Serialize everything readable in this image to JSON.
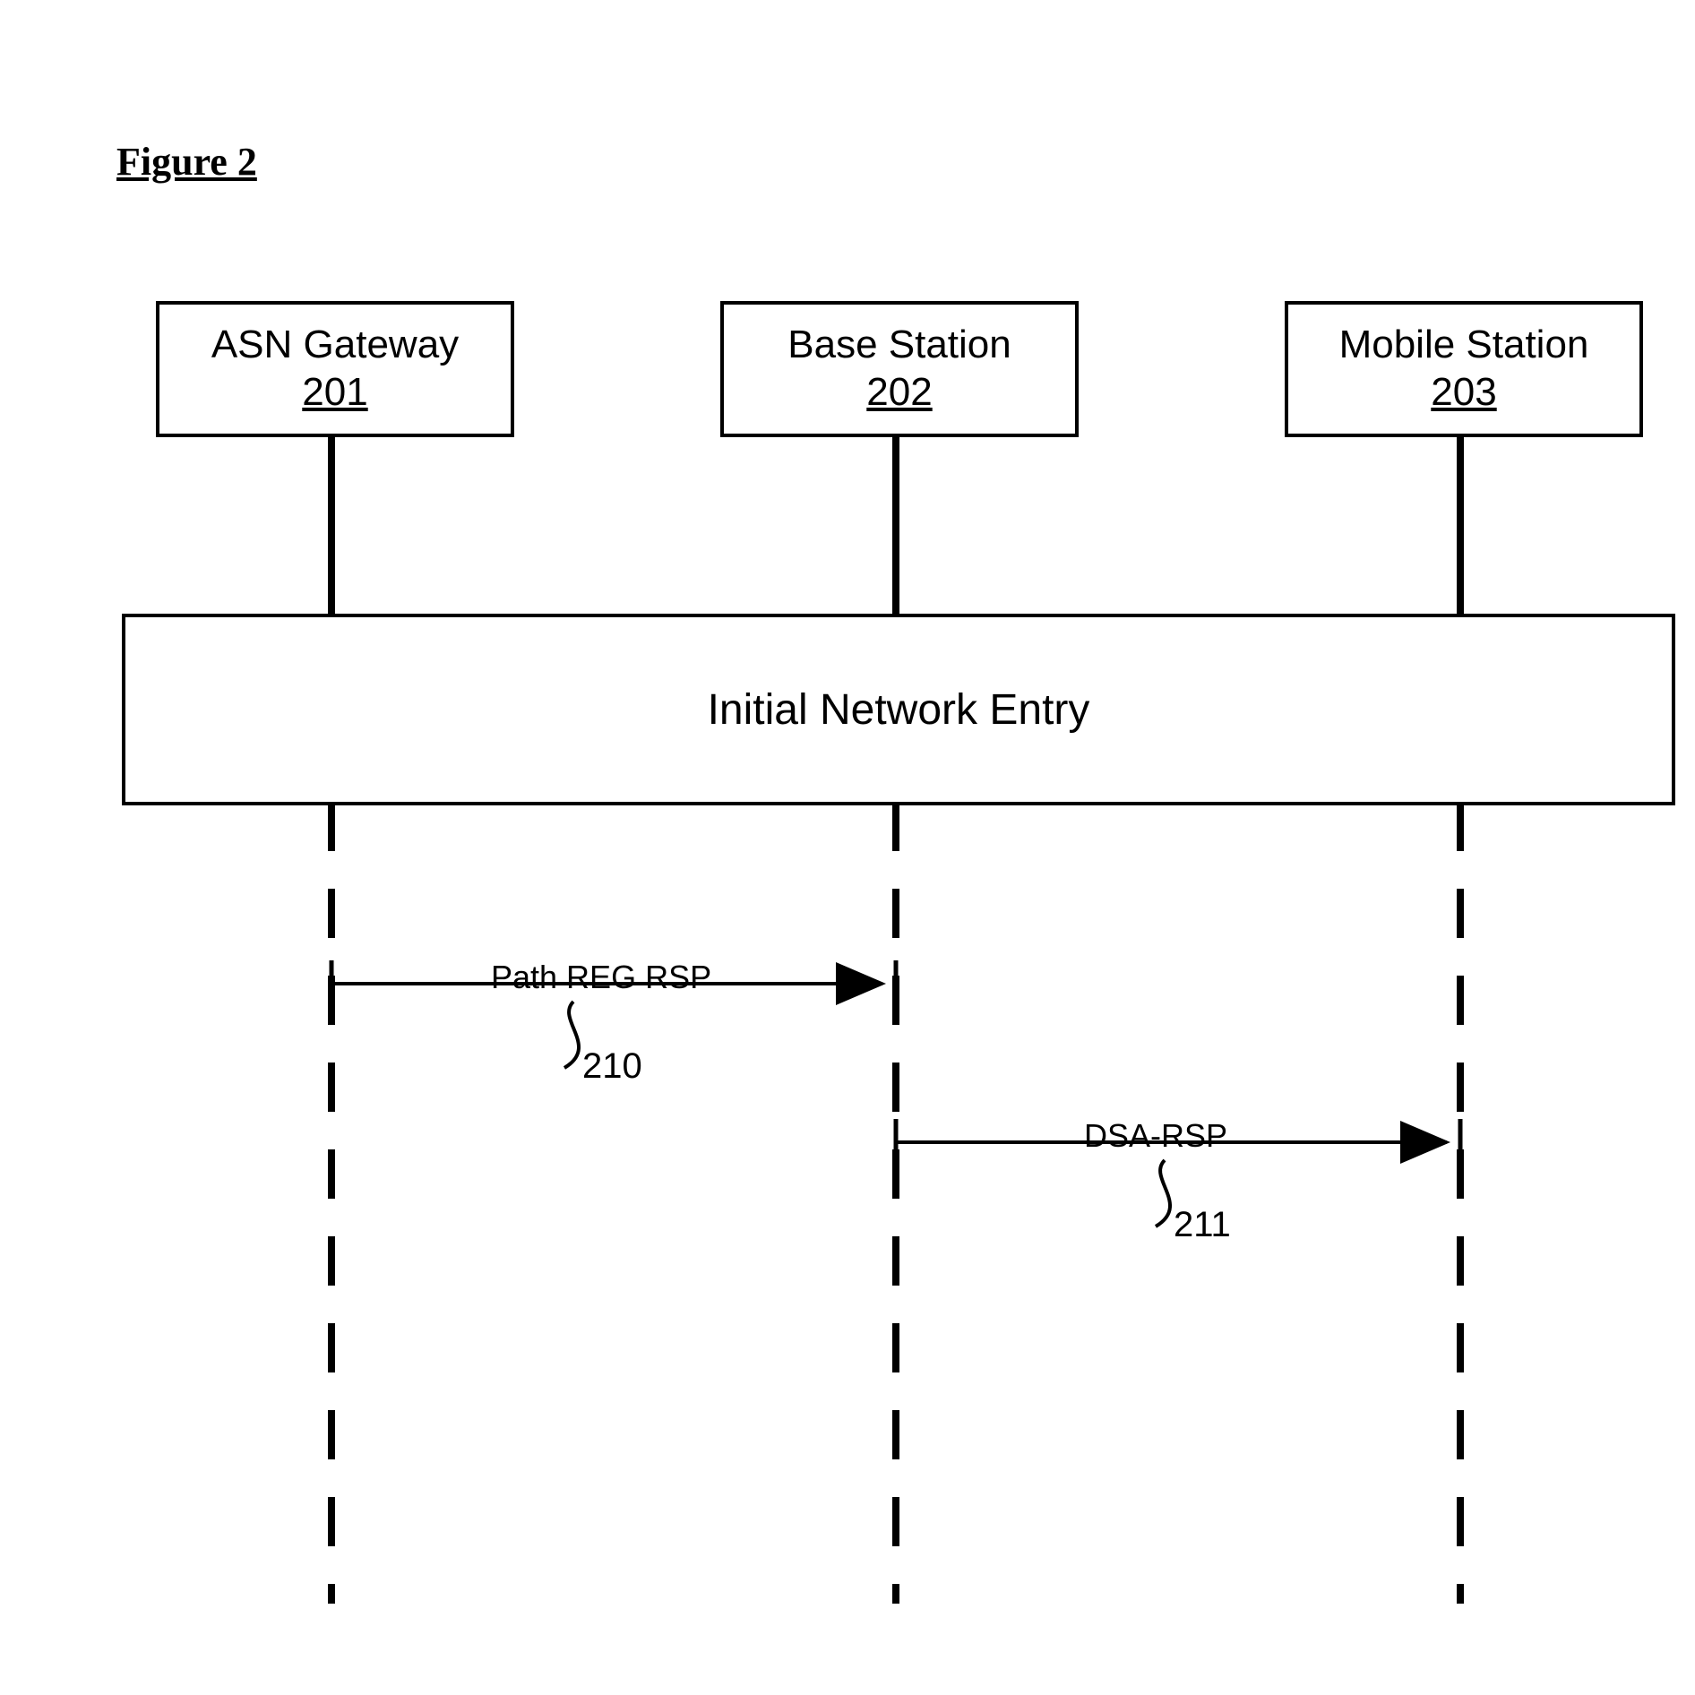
{
  "figure_title": "Figure 2",
  "entities": [
    {
      "name": "ASN Gateway",
      "id": "201"
    },
    {
      "name": "Base Station",
      "id": "202"
    },
    {
      "name": "Mobile Station",
      "id": "203"
    }
  ],
  "phase_label": "Initial Network Entry",
  "messages": [
    {
      "label": "Path REG RSP",
      "ref": "210"
    },
    {
      "label": "DSA-RSP",
      "ref": "211"
    }
  ]
}
